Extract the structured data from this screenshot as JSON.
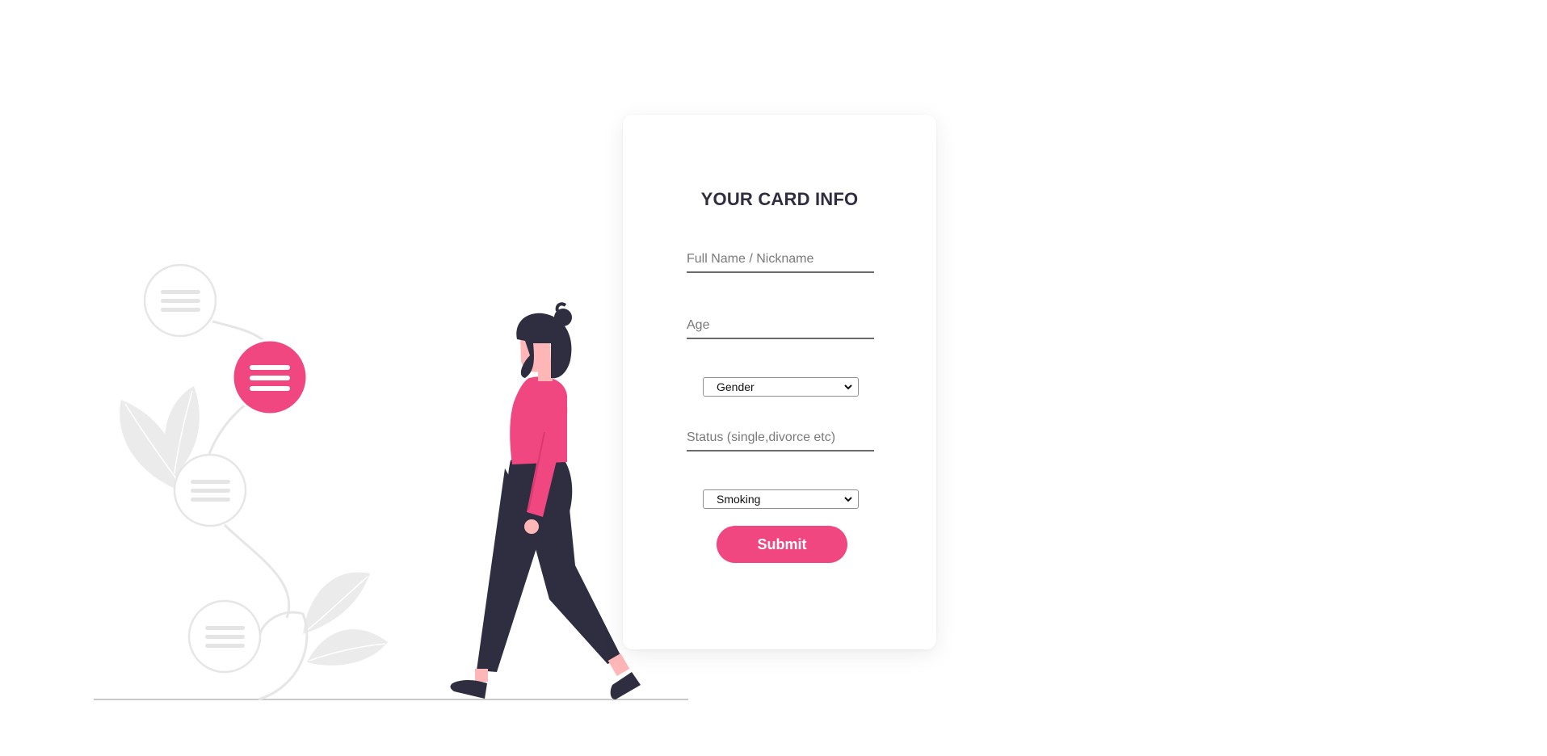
{
  "form": {
    "title": "YOUR CARD INFO",
    "name_placeholder": "Full Name / Nickname",
    "age_placeholder": "Age",
    "gender_selected": "Gender",
    "status_placeholder": "Status (single,divorce etc)",
    "smoking_selected": "Smoking",
    "submit_label": "Submit"
  },
  "colors": {
    "accent": "#f04780",
    "dark": "#2f2e41",
    "skin": "#ffb6b6",
    "light_gray": "#ebebeb",
    "ground": "#cacaca"
  },
  "illustration": {
    "name": "woman-walking-with-menu-plant"
  }
}
